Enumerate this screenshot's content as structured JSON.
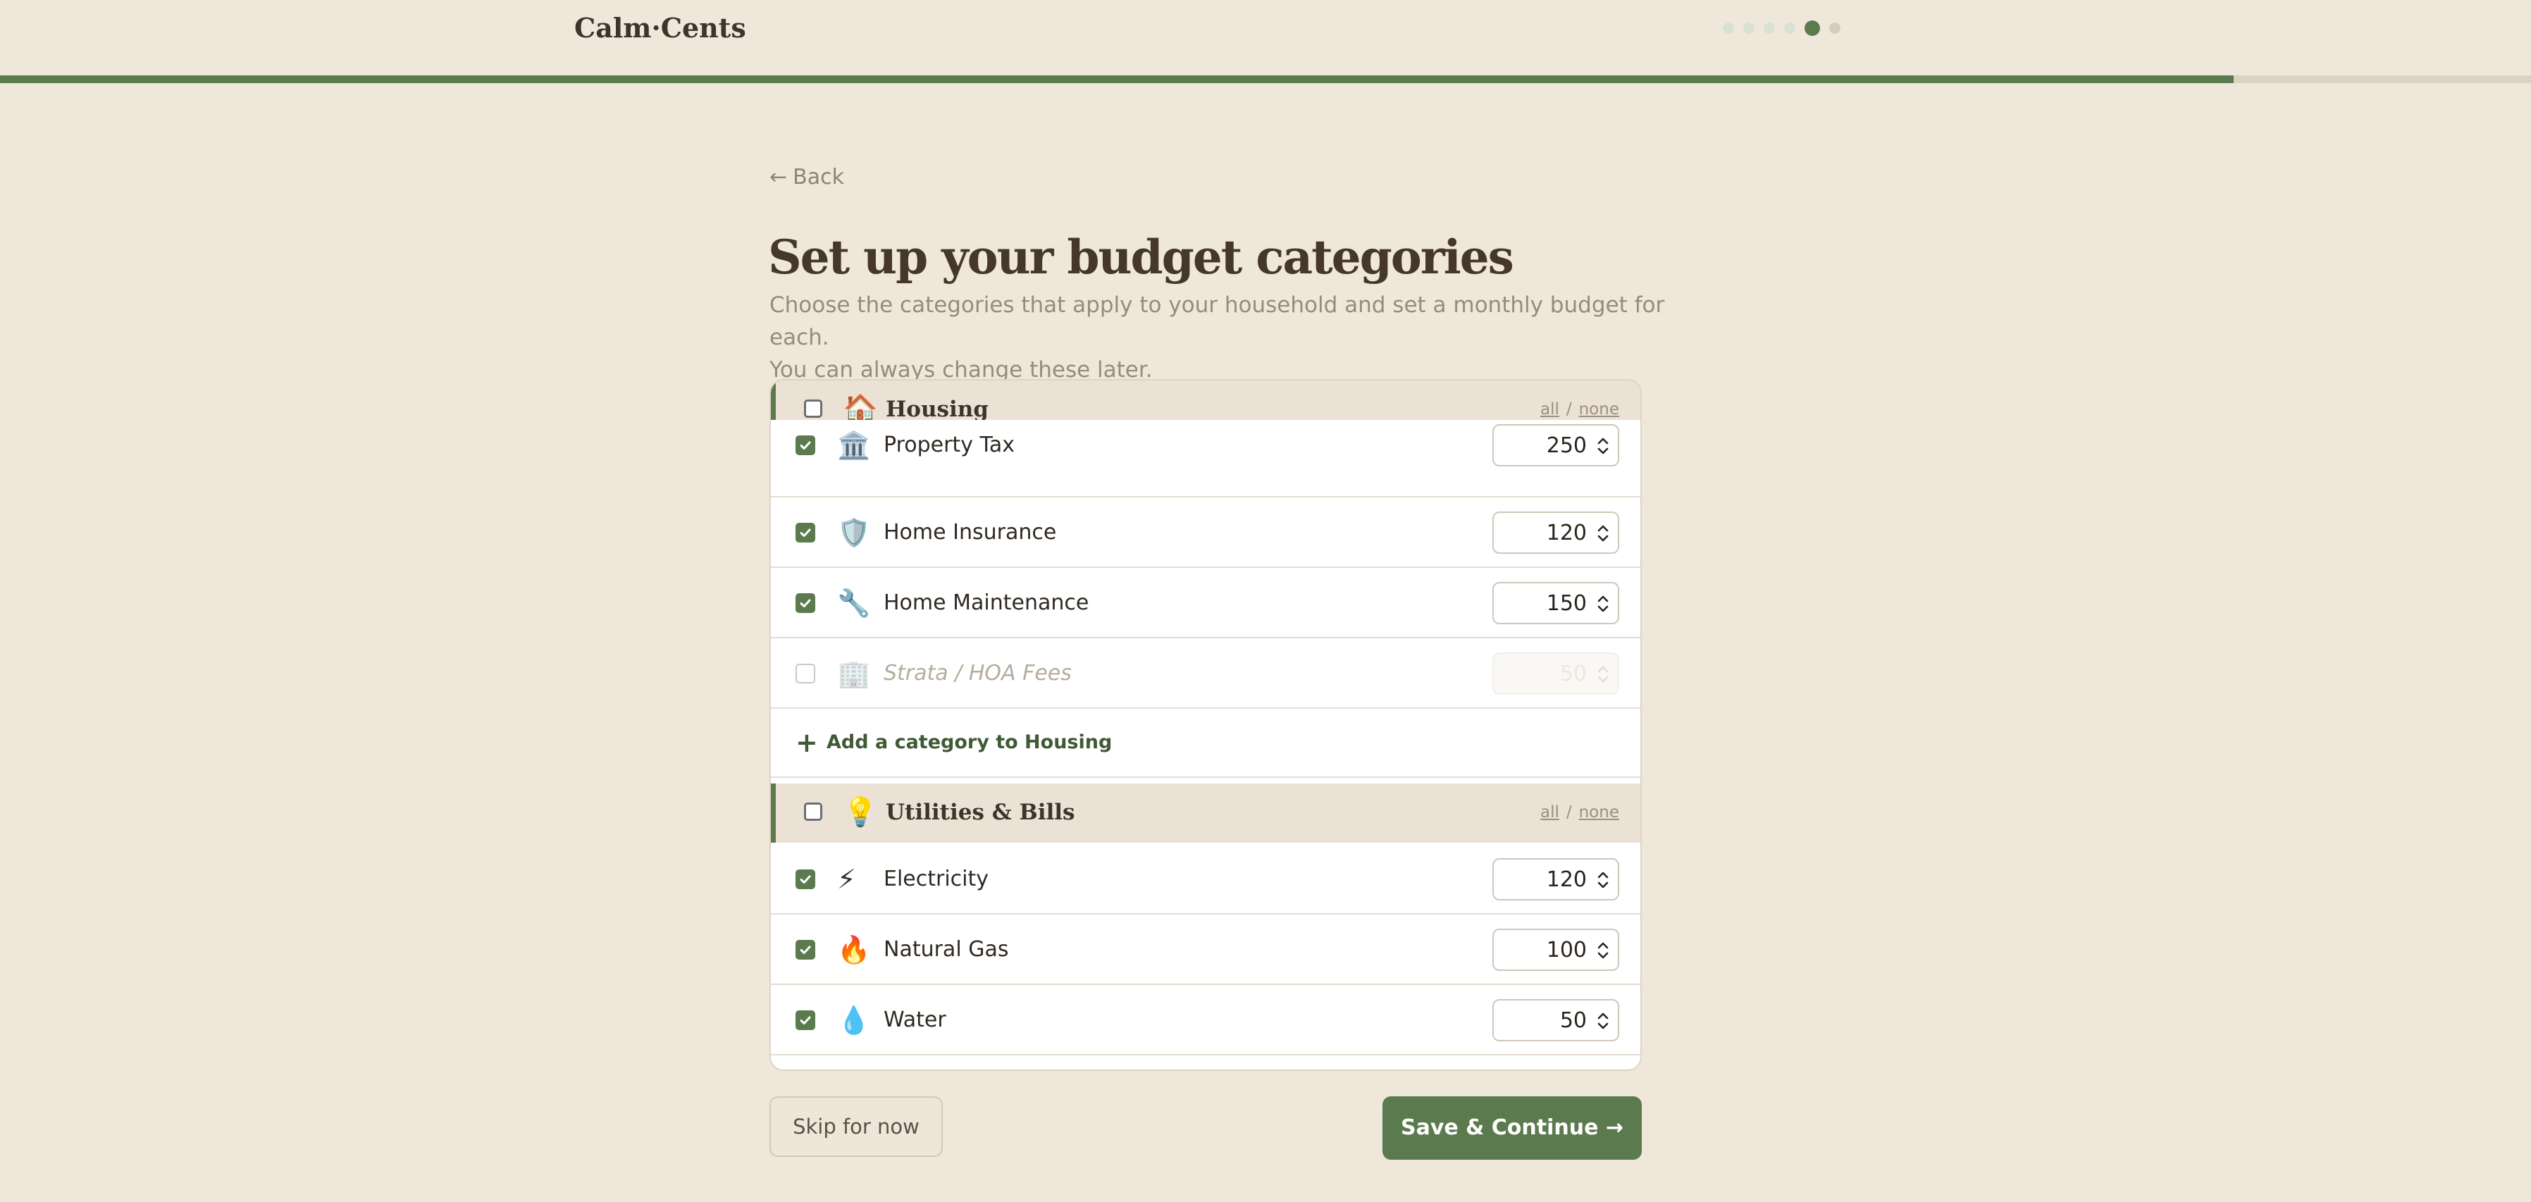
{
  "header": {
    "brand": "Calm·Cents",
    "steps": {
      "total": 6,
      "current": 5
    },
    "progress_fraction": 0.8825
  },
  "intro": {
    "back_arrow": "←",
    "back_label": "Back",
    "title": "Set up your budget categories",
    "subtitle_line1": "Choose the categories that apply to your household and set a monthly budget for each.",
    "subtitle_line2": "You can always change these later."
  },
  "groups": [
    {
      "icon": "🏠",
      "icon_name": "house-icon",
      "title": "Housing",
      "all_label": "all",
      "separator": "/",
      "none_label": "none",
      "items": [
        {
          "icon": "🏛️",
          "icon_name": "bank-building-icon",
          "label": "Property Tax",
          "checked": true,
          "amount": "250"
        },
        {
          "icon": "🛡️",
          "icon_name": "shield-icon",
          "label": "Home Insurance",
          "checked": true,
          "amount": "120"
        },
        {
          "icon": "🔧",
          "icon_name": "wrench-icon",
          "label": "Home Maintenance",
          "checked": true,
          "amount": "150"
        },
        {
          "icon": "🏢",
          "icon_name": "office-building-icon",
          "label": "Strata / HOA Fees",
          "checked": false,
          "amount": "50"
        }
      ],
      "add_plus": "+",
      "add_label": "Add a category to Housing"
    },
    {
      "icon": "💡",
      "icon_name": "lightbulb-icon",
      "title": "Utilities & Bills",
      "all_label": "all",
      "separator": "/",
      "none_label": "none",
      "items": [
        {
          "icon": "⚡",
          "icon_name": "lightning-icon",
          "label": "Electricity",
          "checked": true,
          "amount": "120"
        },
        {
          "icon": "🔥",
          "icon_name": "flame-icon",
          "label": "Natural Gas",
          "checked": true,
          "amount": "100"
        },
        {
          "icon": "💧",
          "icon_name": "water-drop-icon",
          "label": "Water",
          "checked": true,
          "amount": "50"
        }
      ]
    }
  ],
  "footer": {
    "skip_label": "Skip for now",
    "save_label": "Save & Continue →"
  },
  "colors": {
    "accent": "#5b7a4e",
    "background": "#f0e7db",
    "group_header_bg": "#ebe2d5"
  }
}
